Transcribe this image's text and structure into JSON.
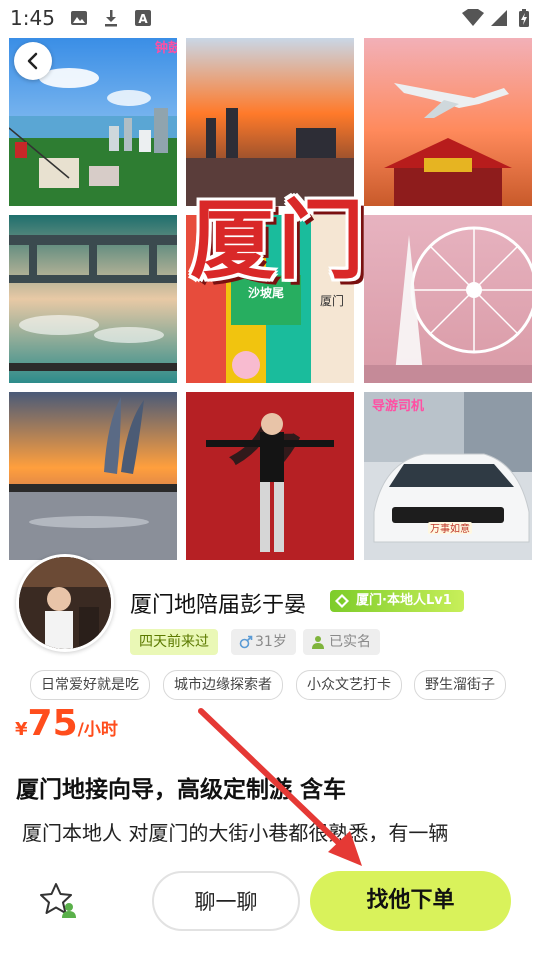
{
  "status_bar": {
    "time": "1:45",
    "icons": [
      "image-icon",
      "download-icon",
      "a-icon",
      "wifi-icon",
      "signal-icon",
      "battery-charging-icon"
    ]
  },
  "gallery": {
    "title_overlay": "厦门",
    "tile_tags": {
      "top_left": "钟鼓",
      "bottom_right": "导游司机",
      "center_sign_1": "沙坡尾",
      "center_sign_2": "厦门",
      "center_sign_3": "厦门",
      "car_plate": "万事如意"
    },
    "page_indicator": {
      "count": 3,
      "active": 1
    }
  },
  "profile": {
    "name": "厦门地陪届彭于晏",
    "level_badge": "厦门·本地人Lv1",
    "visit_chip": "四天前来过",
    "age_chip": "31岁",
    "verified_chip": "已实名",
    "tags": [
      "日常爱好就是吃",
      "城市边缘探索者",
      "小众文艺打卡",
      "野生溜街子"
    ],
    "price": {
      "currency": "¥",
      "value": "75",
      "unit": "/小时"
    },
    "headline": "厦门地接向导，高级定制游 含车",
    "description": "厦门本地人 对厦门的大街小巷都很熟悉，有一辆"
  },
  "actions": {
    "chat_label": "聊一聊",
    "order_label": "找他下单"
  },
  "colors": {
    "accent_lime": "#d9f25b",
    "price_orange": "#ff4d1c",
    "annotation_red": "#e53935",
    "title_red": "#d92828"
  }
}
